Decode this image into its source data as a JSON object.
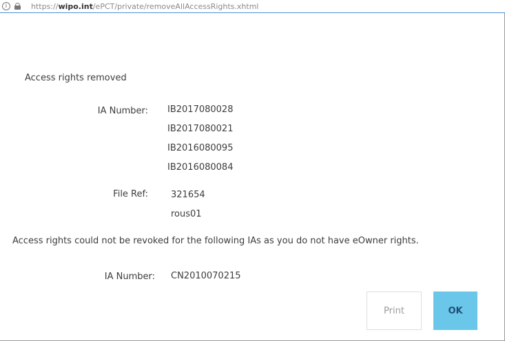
{
  "browser": {
    "url_prefix": "https://",
    "url_host": "wipo.int",
    "url_path": "/ePCT/private/removeAllAccessRights.xhtml",
    "info_icon_glyph": "i"
  },
  "dialog": {
    "removed_title": "Access rights removed",
    "ia_number_label": "IA Number:",
    "ia_numbers": [
      "IB2017080028",
      "IB2017080021",
      "IB2016080095",
      "IB2016080084"
    ],
    "file_ref_label": "File Ref:",
    "file_refs": [
      "321654",
      "rous01"
    ],
    "not_revoked_message": "Access rights could not be revoked for the following IAs as you do not have eOwner rights.",
    "failed_ia_label": "IA Number:",
    "failed_ia_numbers": [
      "CN2010070215"
    ]
  },
  "buttons": {
    "print_label": "Print",
    "ok_label": "OK"
  },
  "colors": {
    "ok_button": "#6bc7ea",
    "url_border": "#4d8fd6"
  }
}
